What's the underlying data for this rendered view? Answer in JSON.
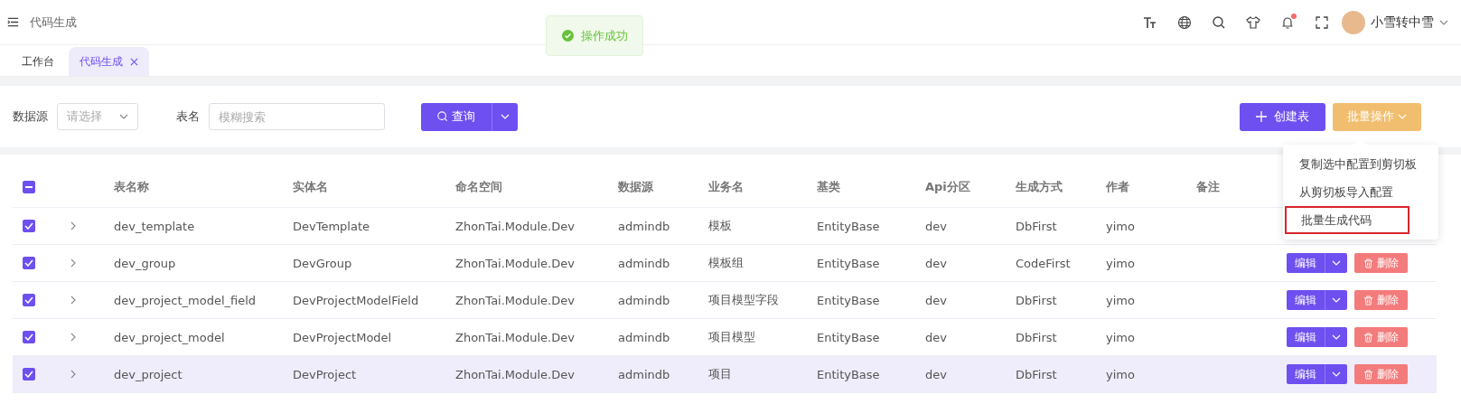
{
  "header": {
    "title": "代码生成",
    "user": {
      "name": "小雪转中雪"
    },
    "notification_dot": true
  },
  "toast": {
    "text": "操作成功"
  },
  "tabs": [
    {
      "label": "工作台",
      "selected": false,
      "closable": false
    },
    {
      "label": "代码生成",
      "selected": true,
      "closable": true
    }
  ],
  "filters": {
    "datasource": {
      "label": "数据源",
      "placeholder": "请选择"
    },
    "table_name": {
      "label": "表名",
      "placeholder": "模糊搜索"
    },
    "query_button": "查询"
  },
  "toolbar": {
    "create_button": "创建表",
    "batch_button": "批量操作"
  },
  "batch_menu": {
    "items": [
      {
        "label": "复制选中配置到剪切板",
        "outlined": false
      },
      {
        "label": "从剪切板导入配置",
        "outlined": false
      },
      {
        "label": "批量生成代码",
        "outlined": true
      }
    ]
  },
  "table": {
    "header_checkbox": {
      "indeterminate": true
    },
    "columns": [
      "表名称",
      "实体名",
      "命名空间",
      "数据源",
      "业务名",
      "基类",
      "Api分区",
      "生成方式",
      "作者",
      "备注"
    ],
    "rows": [
      {
        "checked": true,
        "highlighted": false,
        "cells": [
          "dev_template",
          "DevTemplate",
          "ZhonTai.Module.Dev",
          "admindb",
          "模板",
          "EntityBase",
          "dev",
          "DbFirst",
          "yimo"
        ]
      },
      {
        "checked": true,
        "highlighted": false,
        "actions": {
          "edit": "编辑",
          "delete": "删除"
        },
        "cells": [
          "dev_group",
          "DevGroup",
          "ZhonTai.Module.Dev",
          "admindb",
          "模板组",
          "EntityBase",
          "dev",
          "CodeFirst",
          "yimo"
        ]
      },
      {
        "checked": true,
        "highlighted": false,
        "actions": {
          "edit": "编辑",
          "delete": "删除"
        },
        "cells": [
          "dev_project_model_field",
          "DevProjectModelField",
          "ZhonTai.Module.Dev",
          "admindb",
          "项目模型字段",
          "EntityBase",
          "dev",
          "DbFirst",
          "yimo"
        ]
      },
      {
        "checked": true,
        "highlighted": false,
        "actions": {
          "edit": "编辑",
          "delete": "删除"
        },
        "cells": [
          "dev_project_model",
          "DevProjectModel",
          "ZhonTai.Module.Dev",
          "admindb",
          "项目模型",
          "EntityBase",
          "dev",
          "DbFirst",
          "yimo"
        ]
      },
      {
        "checked": true,
        "highlighted": true,
        "actions": {
          "edit": "编辑",
          "delete": "删除"
        },
        "cells": [
          "dev_project",
          "DevProject",
          "ZhonTai.Module.Dev",
          "admindb",
          "项目",
          "EntityBase",
          "dev",
          "DbFirst",
          "yimo"
        ]
      }
    ]
  }
}
